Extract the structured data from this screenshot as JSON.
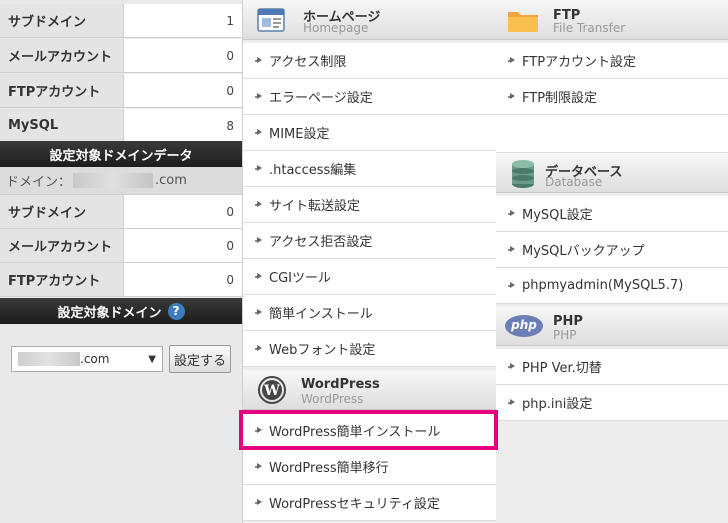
{
  "top_stats": [
    {
      "label": "サブドメイン",
      "value": "1"
    },
    {
      "label": "メールアカウント",
      "value": "0"
    },
    {
      "label": "FTPアカウント",
      "value": "0"
    },
    {
      "label": "MySQL",
      "value": "8"
    }
  ],
  "target_domain_data": {
    "title": "設定対象ドメインデータ",
    "domain_label": "ドメイン：",
    "domain_suffix": ".com",
    "stats": [
      {
        "label": "サブドメイン",
        "value": "0"
      },
      {
        "label": "メールアカウント",
        "value": "0"
      },
      {
        "label": "FTPアカウント",
        "value": "0"
      }
    ]
  },
  "target_domain": {
    "title": "設定対象ドメイン",
    "help": "?",
    "select_value_suffix": ".com",
    "set_button": "設定する"
  },
  "homepage": {
    "title": "ホームページ",
    "subtitle": "Homepage",
    "items": [
      "アクセス制限",
      "エラーページ設定",
      "MIME設定",
      ".htaccess編集",
      "サイト転送設定",
      "アクセス拒否設定",
      "CGIツール",
      "簡単インストール",
      "Webフォント設定"
    ]
  },
  "wordpress": {
    "title": "WordPress",
    "subtitle": "WordPress",
    "items": [
      "WordPress簡単インストール",
      "WordPress簡単移行",
      "WordPressセキュリティ設定"
    ]
  },
  "ftp": {
    "title": "FTP",
    "subtitle": "File Transfer",
    "items": [
      "FTPアカウント設定",
      "FTP制限設定"
    ]
  },
  "database": {
    "title": "データベース",
    "subtitle": "Database",
    "items": [
      "MySQL設定",
      "MySQLバックアップ",
      "phpmyadmin(MySQL5.7)"
    ]
  },
  "php": {
    "title": "PHP",
    "subtitle": "PHP",
    "icon_text": "php",
    "items": [
      "PHP Ver.切替",
      "php.ini設定"
    ]
  },
  "colors": {
    "highlight": "#e4007f",
    "help_icon": "#3d7dbb",
    "php_icon": "#6c7eb7"
  }
}
